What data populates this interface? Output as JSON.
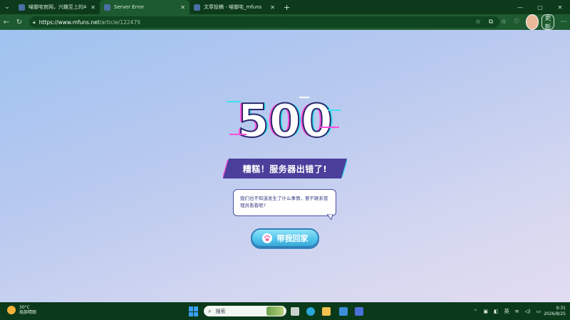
{
  "browser": {
    "tabs": [
      {
        "title": "喵御宅官网，兴趣至上的ACGN社",
        "active": false
      },
      {
        "title": "Server Error",
        "active": true
      },
      {
        "title": "文章投稿 - 喵御宅_mfuns",
        "active": false
      }
    ],
    "url": {
      "host": "https://www.mfuns.net",
      "path": "/article/122479"
    },
    "update_label": "更新"
  },
  "page": {
    "error_code": "500",
    "banner": "糟糕！服务器出错了!",
    "bubble": "我们也不知道发生了什么事情，要不联系管理员看看呢?",
    "home_button": "带我回家"
  },
  "taskbar": {
    "weather_temp": "30°C",
    "weather_desc": "局部晴朗",
    "search_placeholder": "搜索",
    "ime": "英",
    "time": "9:31",
    "date": "2026/8/25"
  },
  "colors": {
    "chrome": "#1e5a30",
    "page_bg_top": "#9ec3ef",
    "banner": "#4b3f9c",
    "button": "#4fc3ea"
  }
}
